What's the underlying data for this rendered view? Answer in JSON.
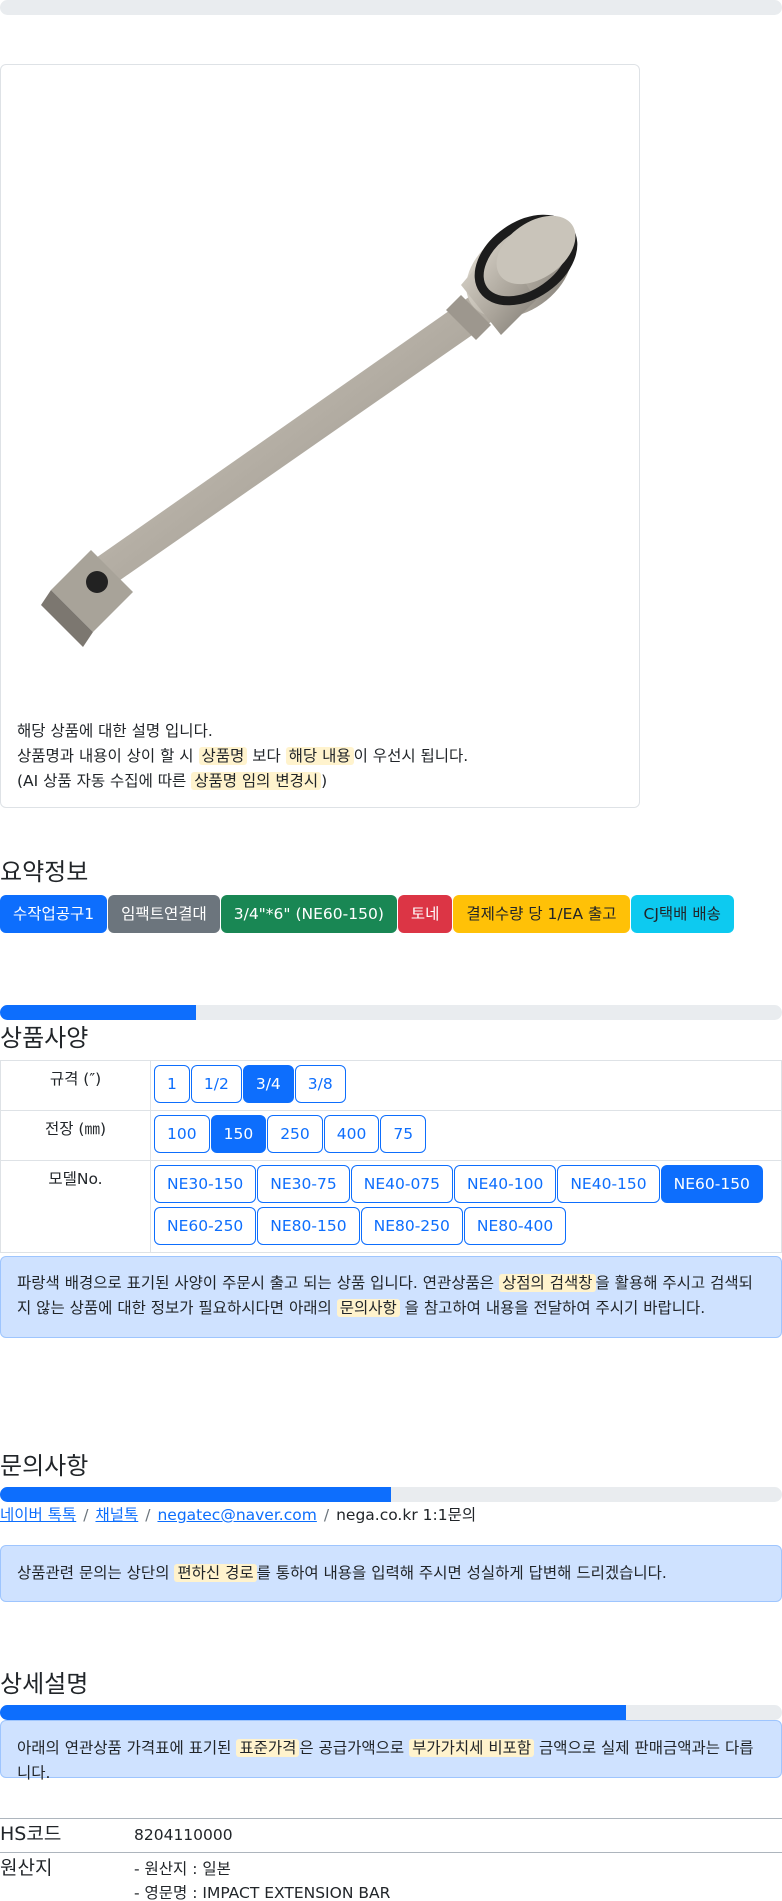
{
  "product_notes": {
    "line1": "해당 상품에 대한 설명 입니다.",
    "line2_a": "상품명과 내용이 상이 할 시 ",
    "line2_hl1": "상품명",
    "line2_b": " 보다 ",
    "line2_hl2": "해당 내용",
    "line2_c": "이 우선시 됩니다.",
    "line3_a": "(AI 상품 자동 수집에 따른 ",
    "line3_hl": "상품명 임의 변경시",
    "line3_b": ")"
  },
  "summary": {
    "title": "요약정보",
    "badges": [
      {
        "label": "수작업공구1",
        "color": "#0d6efd"
      },
      {
        "label": "임팩트연결대",
        "color": "#6c757d"
      },
      {
        "label": "3/4\"*6\" (NE60-150)",
        "color": "#198754"
      },
      {
        "label": "토네",
        "color": "#dc3545"
      },
      {
        "label": "결제수량 당 1/EA 출고",
        "color": "#ffc107"
      },
      {
        "label": "CJ택배 배송",
        "color": "#0dcaf0"
      }
    ]
  },
  "progress": {
    "spec_fraction": 0.25,
    "inquiry_fraction": 0.5,
    "detail_fraction": 0.8
  },
  "spec": {
    "title": "상품사양",
    "rows": [
      {
        "label": "규격 (″)",
        "options": [
          "1",
          "1/2",
          "3/4",
          "3/8"
        ],
        "selected": "3/4"
      },
      {
        "label": "전장 (㎜)",
        "options": [
          "100",
          "150",
          "250",
          "400",
          "75"
        ],
        "selected": "150"
      },
      {
        "label": "모델No.",
        "options": [
          "NE30-150",
          "NE30-75",
          "NE40-075",
          "NE40-100",
          "NE40-150",
          "NE60-150",
          "NE60-250",
          "NE80-150",
          "NE80-250",
          "NE80-400"
        ],
        "selected": "NE60-150"
      }
    ],
    "notice_a": "파랑색 배경으로 표기된 사양이 주문시 출고 되는 상품 입니다. 연관상품은 ",
    "notice_hl1": "상점의 검색창",
    "notice_b": "을 활용해 주시고 검색되지 않는 상품에 대한 정보가 필요하시다면 아래의 ",
    "notice_hl2": "문의사항",
    "notice_c": " 을 참고하여 내용을 전달하여 주시기 바랍니다."
  },
  "inquiry": {
    "title": "문의사항",
    "links": [
      "네이버 톡톡",
      "채널톡",
      "negatec@naver.com"
    ],
    "plain": "nega.co.kr 1:1문의",
    "notice_a": "상품관련 문의는 상단의 ",
    "notice_hl": "편하신 경로",
    "notice_b": "를 통하여 내용을 입력해 주시면 성실하게 답변해 드리겠습니다."
  },
  "detail": {
    "title": "상세설명",
    "notice_a": "아래의 연관상품 가격표에 표기된 ",
    "notice_hl1": "표준가격",
    "notice_b": "은 공급가액으로 ",
    "notice_hl2": "부가가치세 비포함",
    "notice_c": " 금액으로 실제 판매금액과는 다릅니다.",
    "hs_label": "HS코드",
    "hs_value": "8204110000",
    "origin_label": "원산지",
    "origin_line1": "- 원산지 : 일본",
    "origin_line2": "- 영문명 : IMPACT EXTENSION BAR"
  }
}
